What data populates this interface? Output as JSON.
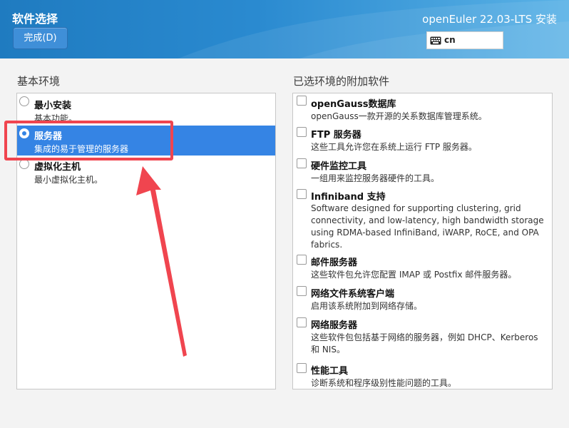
{
  "header": {
    "page_title": "软件选择",
    "done_button": "完成(D)",
    "product_title": "openEuler 22.03-LTS 安装",
    "keyboard_layout": "cn"
  },
  "base_env": {
    "label": "基本环境",
    "items": [
      {
        "name": "最小安装",
        "desc": "基本功能。",
        "selected": false
      },
      {
        "name": "服务器",
        "desc": "集成的易于管理的服务器",
        "selected": true
      },
      {
        "name": "虚拟化主机",
        "desc": "最小虚拟化主机。",
        "selected": false
      }
    ]
  },
  "addons": {
    "label": "已选环境的附加软件",
    "items": [
      {
        "name": "openGauss数据库",
        "desc": "openGauss一款开源的关系数据库管理系统。",
        "checked": false
      },
      {
        "name": "FTP 服务器",
        "desc": "这些工具允许您在系统上运行 FTP 服务器。",
        "checked": false
      },
      {
        "name": "硬件监控工具",
        "desc": "一组用来监控服务器硬件的工具。",
        "checked": false
      },
      {
        "name": "Infiniband 支持",
        "desc": "Software designed for supporting clustering, grid connectivity, and low-latency, high bandwidth storage using RDMA-based InfiniBand, iWARP, RoCE, and OPA fabrics.",
        "checked": false
      },
      {
        "name": "邮件服务器",
        "desc": "这些软件包允许您配置 IMAP 或 Postfix 邮件服务器。",
        "checked": false
      },
      {
        "name": "网络文件系统客户端",
        "desc": "启用该系统附加到网络存储。",
        "checked": false
      },
      {
        "name": "网络服务器",
        "desc": "这些软件包包括基于网络的服务器，例如 DHCP、Kerberos 和 NIS。",
        "checked": false
      },
      {
        "name": "性能工具",
        "desc": "诊断系统和程序级别性能问题的工具。",
        "checked": false
      }
    ]
  },
  "colors": {
    "header_start": "#1f7bc0",
    "header_end": "#5ab2e6",
    "selection": "#3584e4",
    "annotation": "#f0454f"
  }
}
